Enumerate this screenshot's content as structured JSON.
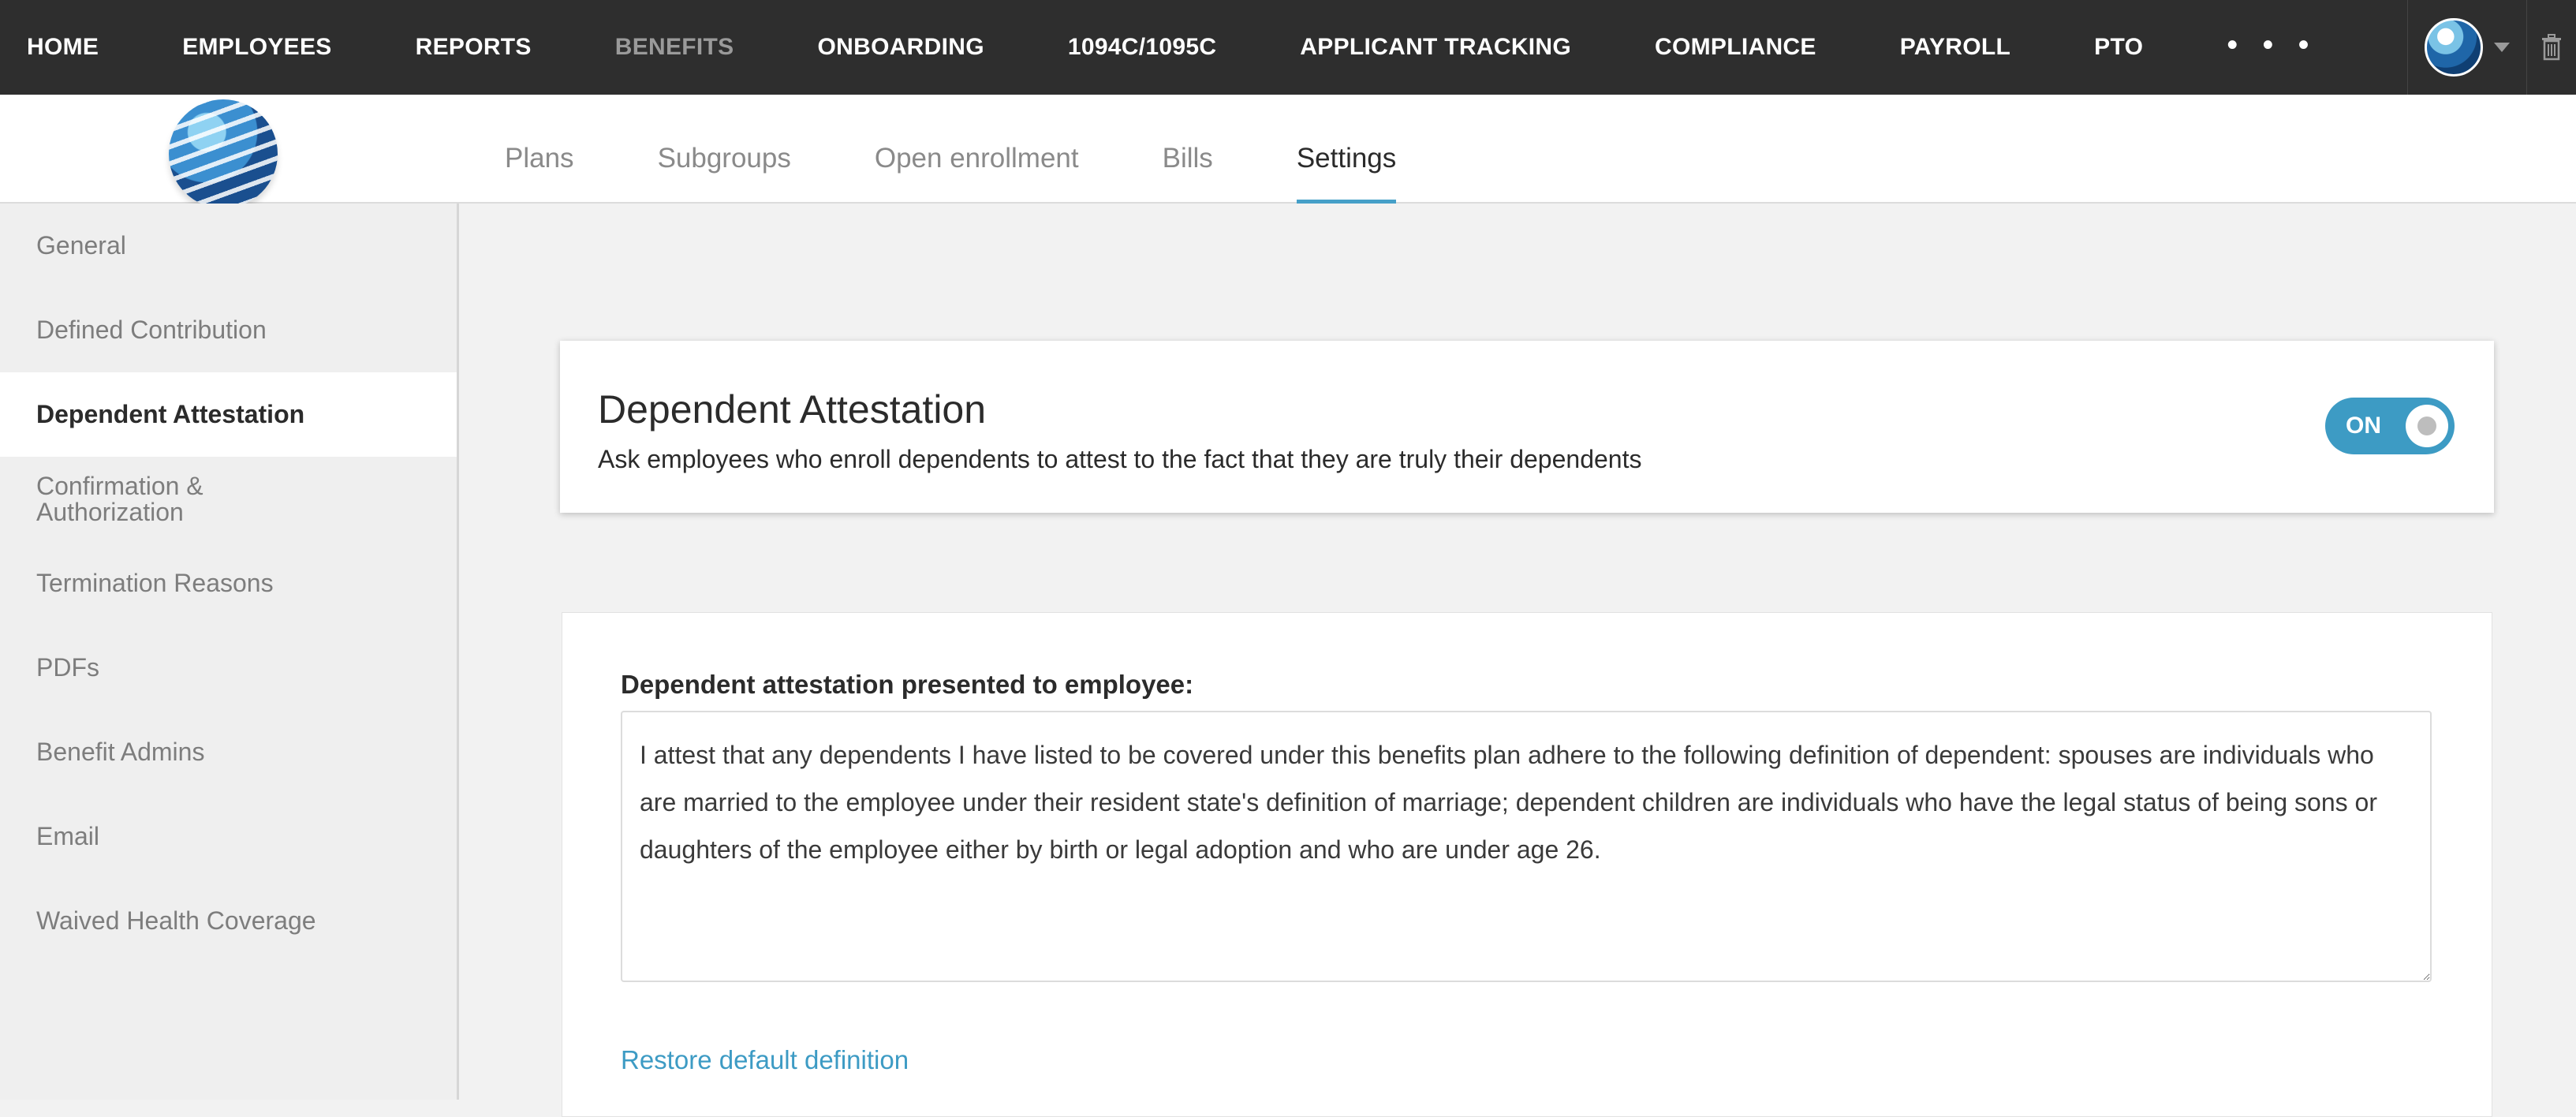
{
  "topnav": {
    "items": [
      {
        "label": "HOME",
        "active": false
      },
      {
        "label": "EMPLOYEES",
        "active": false
      },
      {
        "label": "REPORTS",
        "active": false
      },
      {
        "label": "BENEFITS",
        "active": true
      },
      {
        "label": "ONBOARDING",
        "active": false
      },
      {
        "label": "1094C/1095C",
        "active": false
      },
      {
        "label": "APPLICANT TRACKING",
        "active": false
      },
      {
        "label": "COMPLIANCE",
        "active": false
      },
      {
        "label": "PAYROLL",
        "active": false
      },
      {
        "label": "PTO",
        "active": false
      }
    ],
    "more": "• • •",
    "account_icon": "globe-avatar-icon",
    "trash_icon": "trash-icon",
    "background_color": "#2e2e2e"
  },
  "subheader": {
    "logo_icon": "globe-logo-icon",
    "tabs": [
      {
        "label": "Plans",
        "active": false
      },
      {
        "label": "Subgroups",
        "active": false
      },
      {
        "label": "Open enrollment",
        "active": false
      },
      {
        "label": "Bills",
        "active": false
      },
      {
        "label": "Settings",
        "active": true
      }
    ]
  },
  "sidebar": {
    "items": [
      {
        "label": "General",
        "active": false
      },
      {
        "label": "Defined Contribution",
        "active": false
      },
      {
        "label": "Dependent Attestation",
        "active": true
      },
      {
        "label": "Confirmation & Authorization",
        "active": false
      },
      {
        "label": "Termination Reasons",
        "active": false
      },
      {
        "label": "PDFs",
        "active": false
      },
      {
        "label": "Benefit Admins",
        "active": false
      },
      {
        "label": "Email",
        "active": false
      },
      {
        "label": "Waived Health Coverage",
        "active": false
      }
    ]
  },
  "attestation_card": {
    "title": "Dependent Attestation",
    "description": "Ask employees who enroll dependents to attest to the fact that they are truly their dependents",
    "toggle_label": "ON",
    "toggle_on": true,
    "accent_color": "#3d9bc4"
  },
  "definition_card": {
    "label": "Dependent attestation presented to employee:",
    "text": "I attest that any dependents I have listed to be covered under this benefits plan adhere to the following definition of dependent: spouses are individuals who are married to the employee under their resident state's definition of marriage; dependent children are individuals who have the legal status of being sons or daughters of the employee either by birth or legal adoption and who are under age 26.",
    "restore_link": "Restore default definition"
  }
}
